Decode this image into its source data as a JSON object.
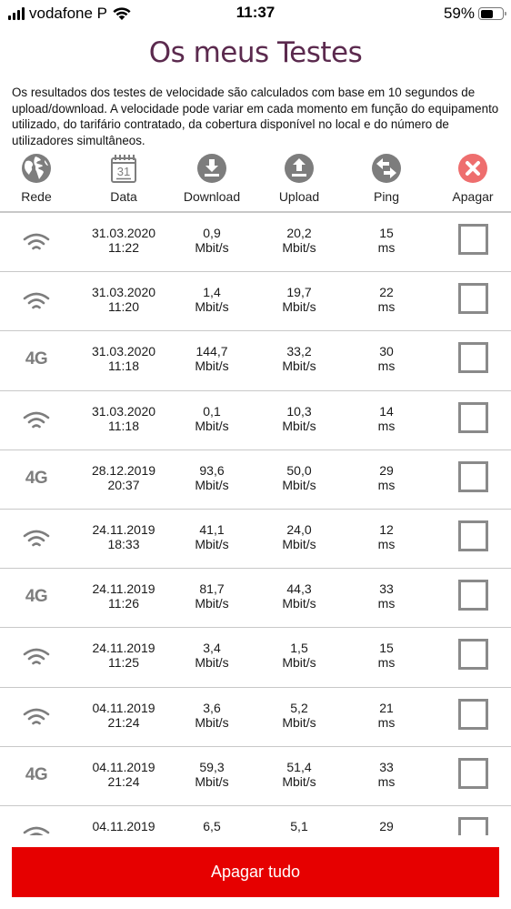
{
  "status_bar": {
    "carrier": "vodafone P",
    "time": "11:37",
    "battery_percent": "59%",
    "battery_level": 0.59
  },
  "page": {
    "title": "Os meus Testes",
    "description": "Os resultados dos testes de velocidade são calculados com base em 10 segundos de upload/download. A velocidade pode variar em cada momento em função do equipamento utilizado, do tarifário contratado, da cobertura disponível no local e do número de utilizadores simultâneos."
  },
  "columns": {
    "rede": {
      "label": "Rede",
      "icon": "globe-icon"
    },
    "data": {
      "label": "Data",
      "icon": "calendar-icon",
      "calendar_day": "31"
    },
    "download": {
      "label": "Download",
      "icon": "download-icon"
    },
    "upload": {
      "label": "Upload",
      "icon": "upload-icon"
    },
    "ping": {
      "label": "Ping",
      "icon": "ping-arrows-icon"
    },
    "apagar": {
      "label": "Apagar",
      "icon": "delete-x-icon"
    }
  },
  "colors": {
    "title": "#5b2a4e",
    "accent_red": "#e60000",
    "delete_icon": "#ee6e6e",
    "icon_gray": "#7d7d7d"
  },
  "rows": [
    {
      "network": "wifi",
      "date": "31.03.2020",
      "time": "11:22",
      "download": "0,9",
      "upload": "20,2",
      "ping": "15",
      "checked": false
    },
    {
      "network": "wifi",
      "date": "31.03.2020",
      "time": "11:20",
      "download": "1,4",
      "upload": "19,7",
      "ping": "22",
      "checked": false
    },
    {
      "network": "4G",
      "date": "31.03.2020",
      "time": "11:18",
      "download": "144,7",
      "upload": "33,2",
      "ping": "30",
      "checked": false
    },
    {
      "network": "wifi",
      "date": "31.03.2020",
      "time": "11:18",
      "download": "0,1",
      "upload": "10,3",
      "ping": "14",
      "checked": false
    },
    {
      "network": "4G",
      "date": "28.12.2019",
      "time": "20:37",
      "download": "93,6",
      "upload": "50,0",
      "ping": "29",
      "checked": false
    },
    {
      "network": "wifi",
      "date": "24.11.2019",
      "time": "18:33",
      "download": "41,1",
      "upload": "24,0",
      "ping": "12",
      "checked": false
    },
    {
      "network": "4G",
      "date": "24.11.2019",
      "time": "11:26",
      "download": "81,7",
      "upload": "44,3",
      "ping": "33",
      "checked": false
    },
    {
      "network": "wifi",
      "date": "24.11.2019",
      "time": "11:25",
      "download": "3,4",
      "upload": "1,5",
      "ping": "15",
      "checked": false
    },
    {
      "network": "wifi",
      "date": "04.11.2019",
      "time": "21:24",
      "download": "3,6",
      "upload": "5,2",
      "ping": "21",
      "checked": false
    },
    {
      "network": "4G",
      "date": "04.11.2019",
      "time": "21:24",
      "download": "59,3",
      "upload": "51,4",
      "ping": "33",
      "checked": false
    },
    {
      "network": "wifi",
      "date": "04.11.2019",
      "time": "",
      "download": "6,5",
      "upload": "5,1",
      "ping": "29",
      "checked": false
    }
  ],
  "units": {
    "speed": "Mbit/s",
    "ping": "ms"
  },
  "footer": {
    "delete_all_label": "Apagar tudo"
  }
}
